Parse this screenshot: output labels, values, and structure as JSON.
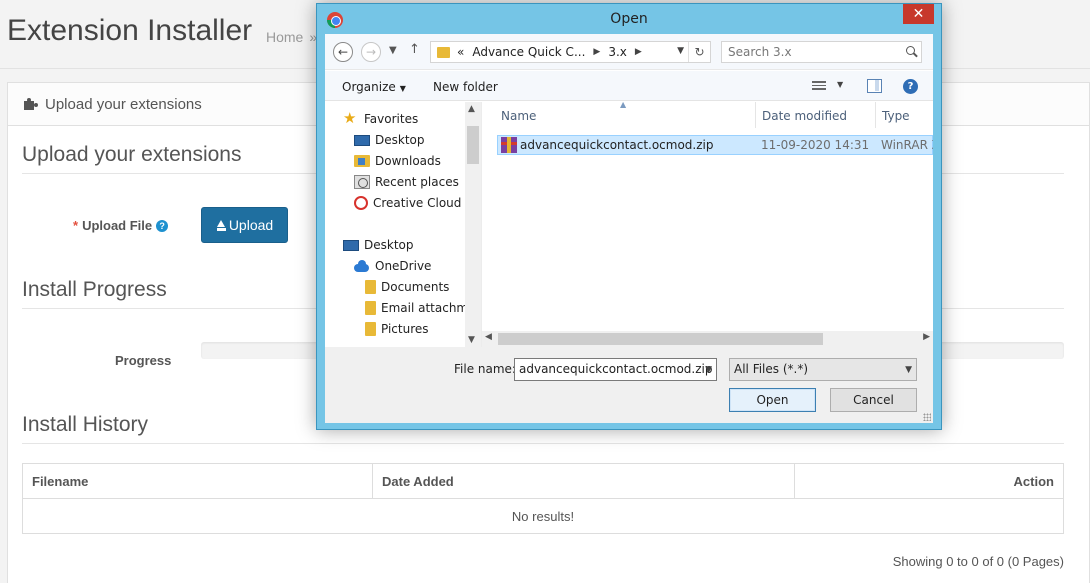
{
  "page": {
    "title": "Extension Installer",
    "breadcrumb_home": "Home",
    "breadcrumb_sep": "»"
  },
  "panel": {
    "heading": "Upload your extensions",
    "section_upload": "Upload your extensions",
    "upload_label": "Upload File",
    "required_mark": "*",
    "help_mark": "?",
    "upload_button": "Upload",
    "section_progress": "Install Progress",
    "progress_label": "Progress",
    "progress_value": 0,
    "section_history": "Install History",
    "table": {
      "headers": [
        "Filename",
        "Date Added",
        "Action"
      ],
      "empty_text": "No results!"
    },
    "pagination_text": "Showing 0 to 0 of 0 (0 Pages)"
  },
  "dialog": {
    "title": "Open",
    "close_glyph": "✕",
    "address": {
      "prefix": "«",
      "segments": [
        "Advance Quick C...",
        "3.x"
      ]
    },
    "search_placeholder": "Search 3.x",
    "toolbar": {
      "organize": "Organize",
      "new_folder": "New folder"
    },
    "nav_items": [
      {
        "label": "Favorites",
        "icon": "star-icon"
      },
      {
        "label": "Desktop",
        "icon": "desktop-icon"
      },
      {
        "label": "Downloads",
        "icon": "downloads-folder-icon"
      },
      {
        "label": "Recent places",
        "icon": "recent-places-icon"
      },
      {
        "label": "Creative Cloud F",
        "icon": "creative-cloud-icon"
      },
      {
        "label": "Desktop",
        "icon": "desktop-icon"
      },
      {
        "label": "OneDrive",
        "icon": "onedrive-icon"
      },
      {
        "label": "Documents",
        "icon": "folder-icon"
      },
      {
        "label": "Email attachme",
        "icon": "folder-icon"
      },
      {
        "label": "Pictures",
        "icon": "folder-icon"
      }
    ],
    "columns": [
      "Name",
      "Date modified",
      "Type"
    ],
    "files": [
      {
        "name": "advancequickcontact.ocmod.zip",
        "date": "11-09-2020 14:31",
        "type": "WinRAR Z"
      }
    ],
    "file_name_label": "File name:",
    "file_name_value": "advancequickcontact.ocmod.zip",
    "file_type_value": "All Files (*.*)",
    "open_button": "Open",
    "cancel_button": "Cancel"
  },
  "colors": {
    "upload_button": "#1f6fa0",
    "dialog_frame": "#75c5e6",
    "close_button": "#c7382b",
    "selected_row": "#cce8ff",
    "required": "#e3503e"
  }
}
